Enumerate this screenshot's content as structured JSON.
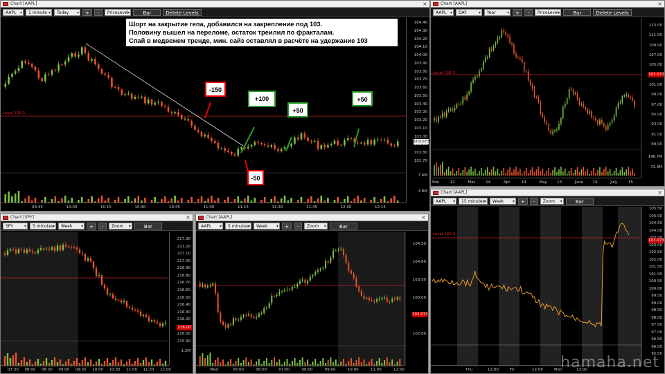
{
  "windows": [
    {
      "title": "Chart [AAPL]",
      "symbol": "AAPL",
      "interval": "1 minute",
      "range": "Today",
      "study": "PriceLevel",
      "plus": "+",
      "minus": "-",
      "bar_btn": "Bar",
      "delete_btn": "Delete Levels",
      "price_ticks": [
        "104.40",
        "104.30",
        "104.20",
        "104.10",
        "104.00",
        "103.90",
        "103.80",
        "103.70",
        "103.60",
        "103.50",
        "103.40",
        "103.30",
        "103.20",
        "103.10",
        "103.00",
        "102.90",
        "102.80",
        "102.70"
      ],
      "vol_ticks": [
        "7.6M",
        "3.8M"
      ],
      "time_ticks": [
        "09:45",
        "10:00",
        "10:15",
        "10:30",
        "10:45",
        "11:00",
        "11:15",
        "11:30",
        "11:45",
        "12:00",
        "12:15"
      ],
      "level_label": "Level 103.3",
      "last_price": "103.073"
    },
    {
      "title": "Chart [AAPL]",
      "symbol": "AAPL",
      "interval": "DAY",
      "range": "Year",
      "study": "PriceLevel",
      "plus": "+",
      "minus": "-",
      "bar_btn": "Bar",
      "delete_btn": "Delete Levels",
      "price_ticks": [
        "113.00",
        "111.00",
        "109.00",
        "107.00",
        "105.00",
        "103.00",
        "101.00",
        "99.00",
        "97.00",
        "95.00",
        "93.00",
        "91.00",
        "89.00"
      ],
      "vol_ticks": [
        "146.7M",
        "73.3M"
      ],
      "time_ticks": [
        "Feb",
        "12",
        "Mar",
        "14",
        "Apr",
        "14",
        "May",
        "13",
        "June",
        "14",
        "July",
        "15"
      ],
      "level_label": "Level 103.3",
      "last_price": "103.073"
    },
    {
      "title": "Chart [SPY]",
      "symbol": "SPY",
      "interval": "5 minutes",
      "range": "Week",
      "study": "Zoom",
      "plus": "+",
      "minus": "-",
      "bar_btn": "Bar",
      "price_ticks": [
        "217.30",
        "217.20",
        "217.10",
        "217.00",
        "216.90",
        "216.80",
        "216.70",
        "216.60",
        "216.50",
        "216.40",
        "216.30",
        "216.20",
        "216.10",
        "216.00",
        "215.90"
      ],
      "vol_ticks": [
        "1.2M"
      ],
      "time_ticks": [
        "07:30",
        "08:00",
        "08:30",
        "09:00",
        "09:30",
        "10:00",
        "10:30",
        "11:00",
        "11:30",
        "12:00"
      ],
      "last_price": "216.00"
    },
    {
      "title": "Chart [AAPL]",
      "symbol": "AAPL",
      "interval": "5 minutes",
      "range": "Week",
      "study": "Zoom",
      "plus": "+",
      "minus": "-",
      "bar_btn": "Bar",
      "price_ticks": [
        "104.50",
        "104.00",
        "103.50",
        "103.00",
        "102.50",
        "102.00"
      ],
      "time_ticks": [
        "Wed",
        "05:00",
        "06:00",
        "07:00",
        "08:00",
        "09:00",
        "10:00",
        "11:00",
        "12:00"
      ],
      "last_price": "103.073"
    },
    {
      "title": "Chart [AAPL]",
      "symbol": "AAPL",
      "interval": "15 minutes",
      "range": "Week",
      "study": "Zoom",
      "plus": "+",
      "minus": "-",
      "bar_btn": "Bar",
      "price_ticks": [
        "105.50",
        "105.00",
        "104.50",
        "104.00",
        "103.50",
        "103.00",
        "102.50",
        "102.00",
        "101.50",
        "101.00",
        "100.50",
        "100.00",
        "99.50",
        "99.00",
        "98.50",
        "98.00",
        "97.50",
        "97.00",
        "96.50",
        "96.00",
        "95.50"
      ],
      "time_ticks": [
        "Thu",
        "12:00",
        "Fri",
        "12:00",
        "Mon",
        "12:00"
      ],
      "level_label": "Level 103.3",
      "last_price": "103.073"
    }
  ],
  "annotation": {
    "line1": "Шорт на закрытие гепа, добавился на закрепление под 103.",
    "line2": "Половину вышел на переломе, остаток треилил по фракталам.",
    "line3": "Спай в медвежем тренде, мин. сайз оставлял в расчёте на удержание 103"
  },
  "callouts": [
    "-150",
    "+100",
    "+50",
    "+50",
    "-50"
  ],
  "watermark": "hamaha.net",
  "colors": {
    "up": "#7fbf3f",
    "down": "#e8532a",
    "level": "#c0202a",
    "bg": "#000000"
  }
}
